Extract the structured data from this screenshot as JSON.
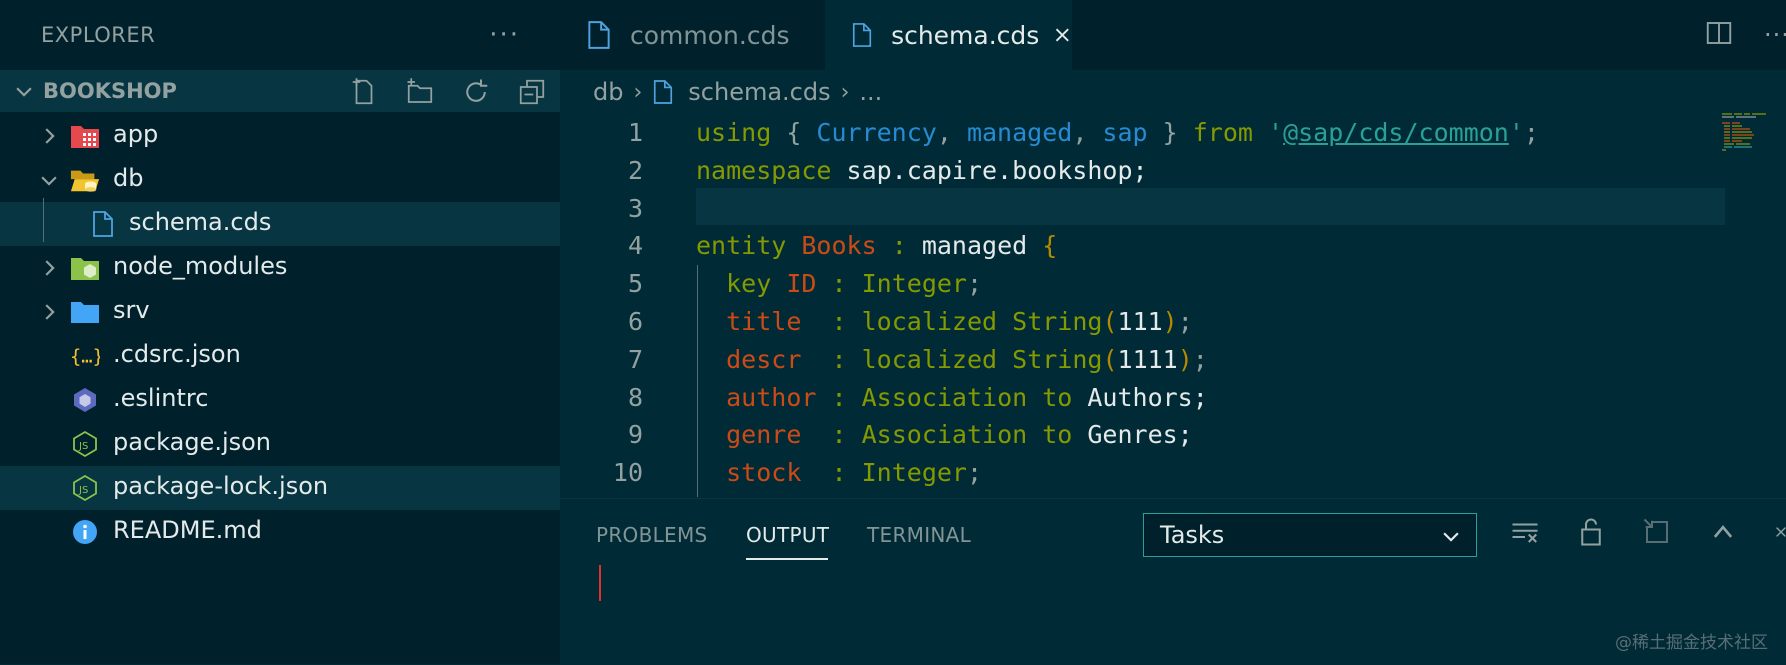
{
  "sidebar": {
    "title": "EXPLORER",
    "more": "···",
    "section": {
      "title": "BOOKSHOP",
      "actions": [
        "new-file-icon",
        "new-folder-icon",
        "refresh-icon",
        "collapse-all-icon"
      ]
    },
    "items": [
      {
        "label": "app",
        "icon": "app-folder-icon",
        "expandable": true,
        "expanded": false,
        "depth": 0
      },
      {
        "label": "db",
        "icon": "folder-open-icon",
        "expandable": true,
        "expanded": true,
        "depth": 0
      },
      {
        "label": "schema.cds",
        "icon": "file-icon",
        "expandable": false,
        "depth": 1
      },
      {
        "label": "node_modules",
        "icon": "node-folder-icon",
        "expandable": true,
        "expanded": false,
        "depth": 0
      },
      {
        "label": "srv",
        "icon": "folder-icon",
        "expandable": true,
        "expanded": false,
        "depth": 0
      },
      {
        "label": ".cdsrc.json",
        "icon": "json-icon",
        "expandable": false,
        "depth": 0
      },
      {
        "label": ".eslintrc",
        "icon": "eslint-icon",
        "expandable": false,
        "depth": 0
      },
      {
        "label": "package.json",
        "icon": "nodejs-icon",
        "expandable": false,
        "depth": 0
      },
      {
        "label": "package-lock.json",
        "icon": "nodejs-icon",
        "expandable": false,
        "depth": 0,
        "selected": true
      },
      {
        "label": "README.md",
        "icon": "info-icon",
        "expandable": false,
        "depth": 0
      }
    ]
  },
  "editor": {
    "tabs": [
      {
        "label": "common.cds",
        "active": false
      },
      {
        "label": "schema.cds",
        "active": true
      }
    ],
    "breadcrumb": [
      "db",
      "schema.cds",
      "..."
    ],
    "lines": [
      {
        "n": "1",
        "text": "using { Currency, managed, sap } from '@sap/cds/common';"
      },
      {
        "n": "2",
        "text": "namespace sap.capire.bookshop;"
      },
      {
        "n": "3",
        "text": ""
      },
      {
        "n": "4",
        "text": "entity Books : managed {"
      },
      {
        "n": "5",
        "text": "  key ID : Integer;"
      },
      {
        "n": "6",
        "text": "  title  : localized String(111);"
      },
      {
        "n": "7",
        "text": "  descr  : localized String(1111);"
      },
      {
        "n": "8",
        "text": "  author : Association to Authors;"
      },
      {
        "n": "9",
        "text": "  genre  : Association to Genres;"
      },
      {
        "n": "10",
        "text": "  stock  : Integer;"
      }
    ]
  },
  "panel": {
    "tabs": [
      "PROBLEMS",
      "OUTPUT",
      "TERMINAL"
    ],
    "active_tab": "OUTPUT",
    "select_value": "Tasks"
  },
  "watermark": "@稀土掘金技术社区",
  "colors": {
    "background": "#002b36",
    "sidebar": "#00212b",
    "selection": "#073642",
    "keyword": "#859900",
    "type": "#268bd2",
    "string": "#2aa198",
    "identifier": "#cb4b16",
    "bracket": "#b58900"
  }
}
